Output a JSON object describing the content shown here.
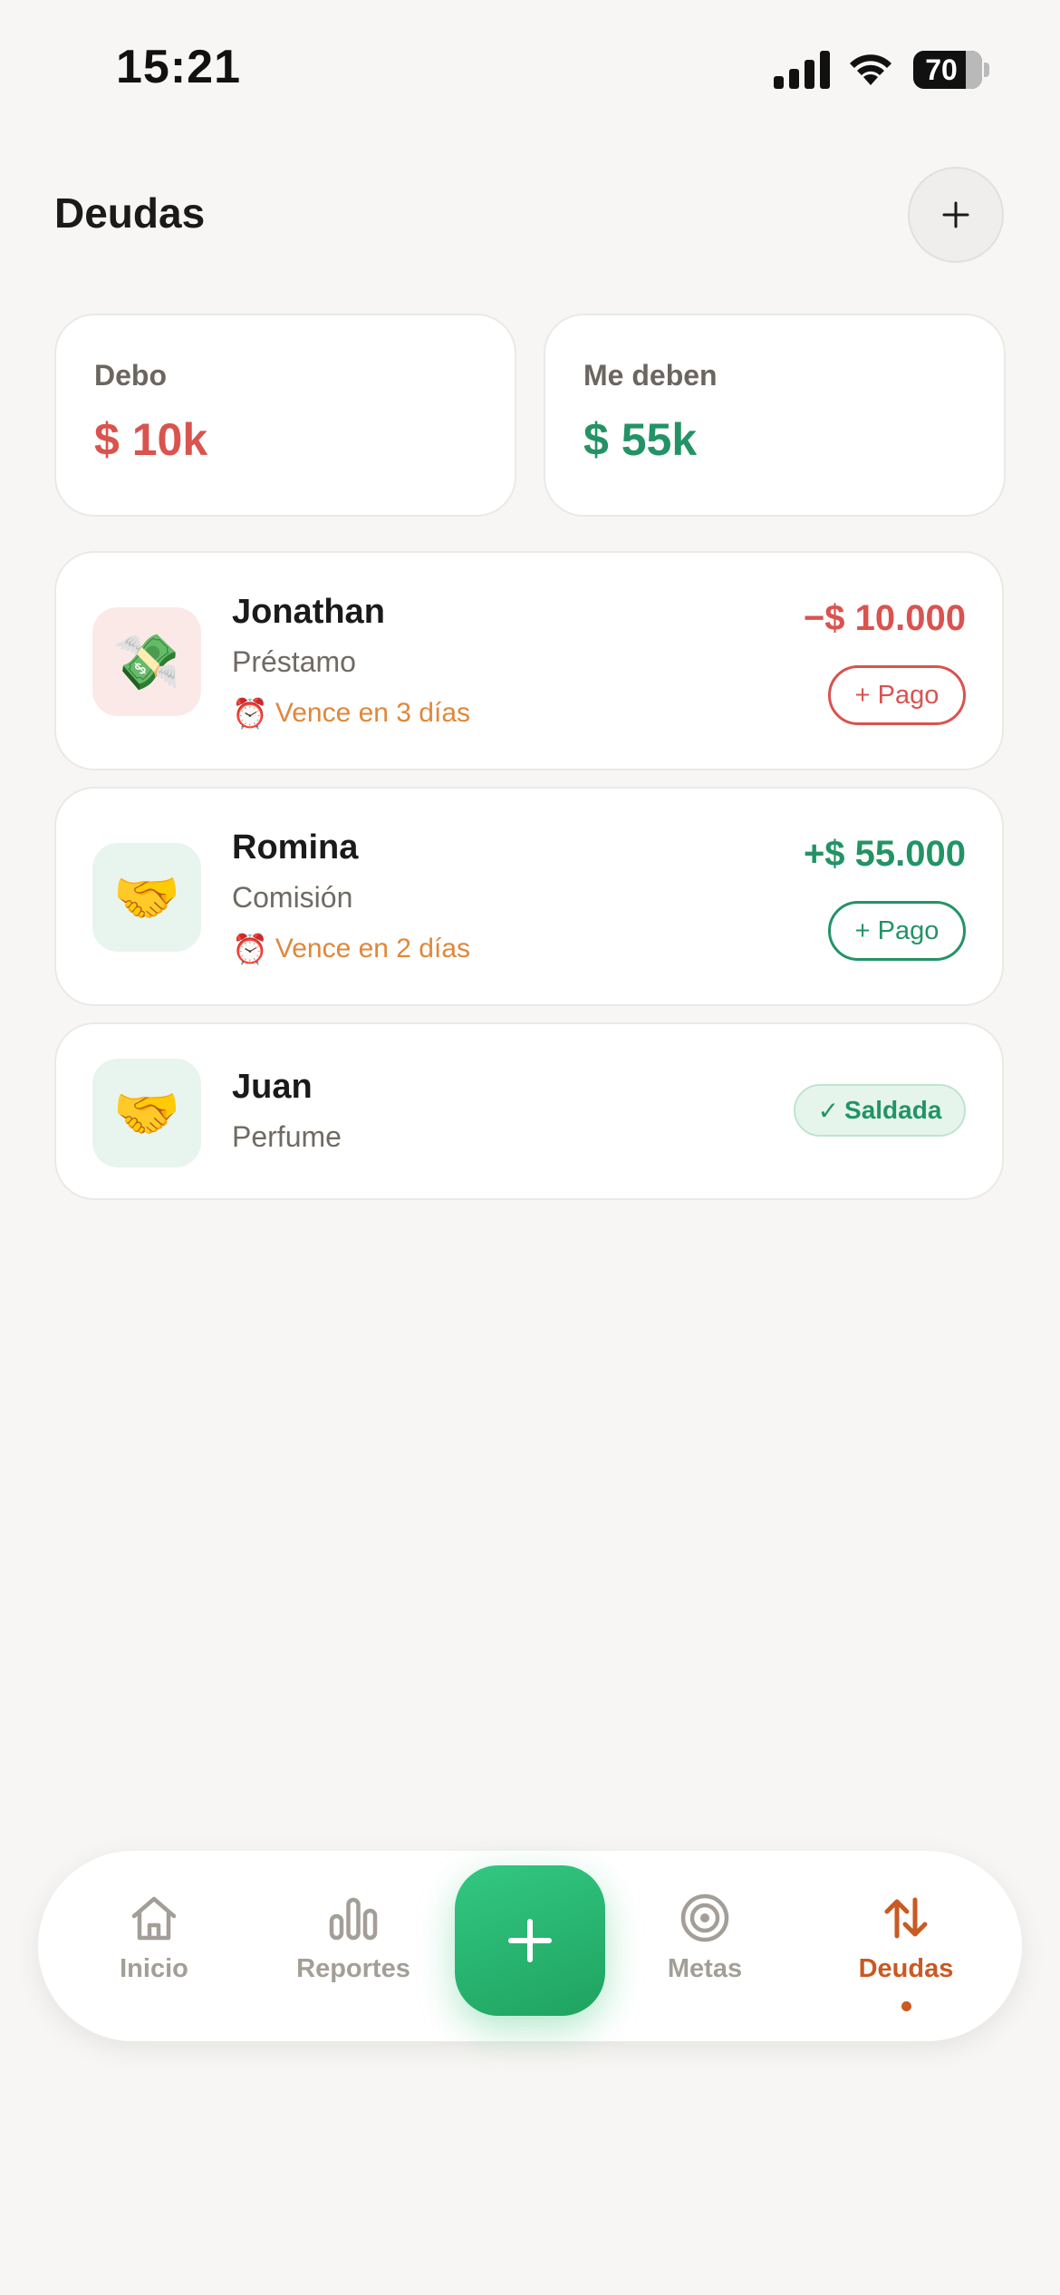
{
  "status_bar": {
    "time": "15:21",
    "battery": "70"
  },
  "header": {
    "title": "Deudas",
    "add_icon": "plus-icon"
  },
  "summary": {
    "owe": {
      "label": "Debo",
      "value": "$ 10k",
      "color": "#d9534f"
    },
    "owed": {
      "label": "Me deben",
      "value": "$ 55k",
      "color": "#239366"
    }
  },
  "debts": [
    {
      "name": "Jonathan",
      "concept": "Préstamo",
      "due": "Vence en 3 días",
      "amount": "−$ 10.000",
      "action": "+ Pago",
      "icon": "money-with-wings-icon",
      "emoji": "💸"
    },
    {
      "name": "Romina",
      "concept": "Comisión",
      "due": "Vence en 2 días",
      "amount": "+$ 55.000",
      "action": "+ Pago",
      "icon": "handshake-icon",
      "emoji": "🤝"
    },
    {
      "name": "Juan",
      "concept": "Perfume",
      "status": "Saldada",
      "status_mark": "✓",
      "icon": "handshake-icon",
      "emoji": "🤝"
    }
  ],
  "due_icon": "⏰",
  "tabs": [
    {
      "label": "Inicio",
      "icon": "home-icon"
    },
    {
      "label": "Reportes",
      "icon": "bar-chart-icon"
    },
    {
      "label": "Metas",
      "icon": "target-icon"
    },
    {
      "label": "Deudas",
      "icon": "transfer-arrows-icon",
      "active": true
    }
  ],
  "fab_icon": "plus-icon",
  "colors": {
    "accent": "#c95a22",
    "positive": "#239366",
    "negative": "#d9534f",
    "due": "#e0873a"
  }
}
